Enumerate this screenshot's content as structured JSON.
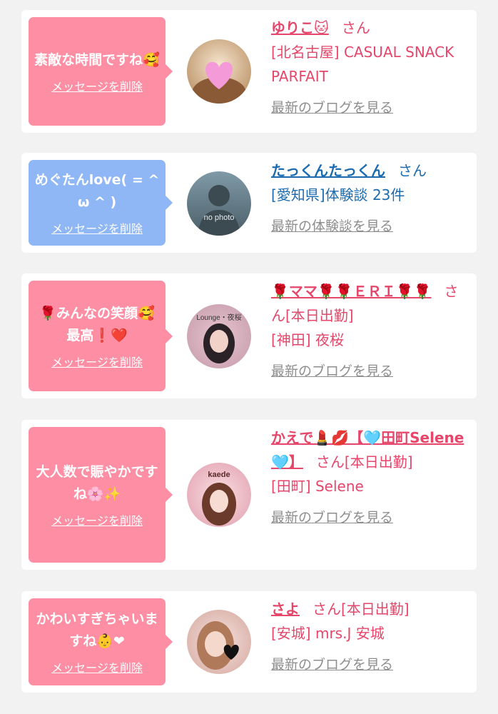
{
  "cards": [
    {
      "message": "素敵な時間ですね🥰",
      "delete_label": "メッセージを削除",
      "name": "ゆりこ🐱",
      "honorific": "さん",
      "shop": "[北名古屋] CASUAL SNACK PARFAIT",
      "more_label": "最新のブログを見る"
    },
    {
      "message": "めぐたんlove( = ^ ω ^ )",
      "delete_label": "メッセージを削除",
      "name": "たっくんたっくん",
      "honorific": "さん",
      "detail": "[愛知県]体験談 23件",
      "more_label": "最新の体験談を見る",
      "avatar_text": "no photo"
    },
    {
      "message": "🌹みんなの笑顔🥰最高❗️❤️",
      "delete_label": "メッセージを削除",
      "name": "🌹ママ🌹🌹ＥＲＩ🌹🌹",
      "honorific": "さん",
      "status": "[本日出勤]",
      "shop": "[神田] 夜桜",
      "more_label": "最新のブログを見る",
      "avatar_text": "Lounge・夜桜"
    },
    {
      "message": "大人数で賑やかですね🌸✨",
      "delete_label": "メッセージを削除",
      "name": "かえで💄💋【🩵田町Selene🩵】",
      "honorific": "さん",
      "status": "[本日出勤]",
      "shop": "[田町] Selene",
      "more_label": "最新のブログを見る",
      "avatar_text": "kaede"
    },
    {
      "message": "かわいすぎちゃいますね👶❤",
      "delete_label": "メッセージを削除",
      "name": "さよ",
      "honorific": "さん",
      "status": "[本日出勤]",
      "shop": "[安城] mrs.J 安城",
      "more_label": "最新のブログを見る"
    }
  ],
  "colors": {
    "pink_bubble": "#fd8ea3",
    "blue_bubble": "#8fb6f5",
    "name_pink": "#e5466a",
    "name_blue": "#1c6bb0",
    "link_gray": "#8e8e8e"
  },
  "icons": [
    "heart-sticker",
    "silhouette-no-photo",
    "girl-photo"
  ]
}
